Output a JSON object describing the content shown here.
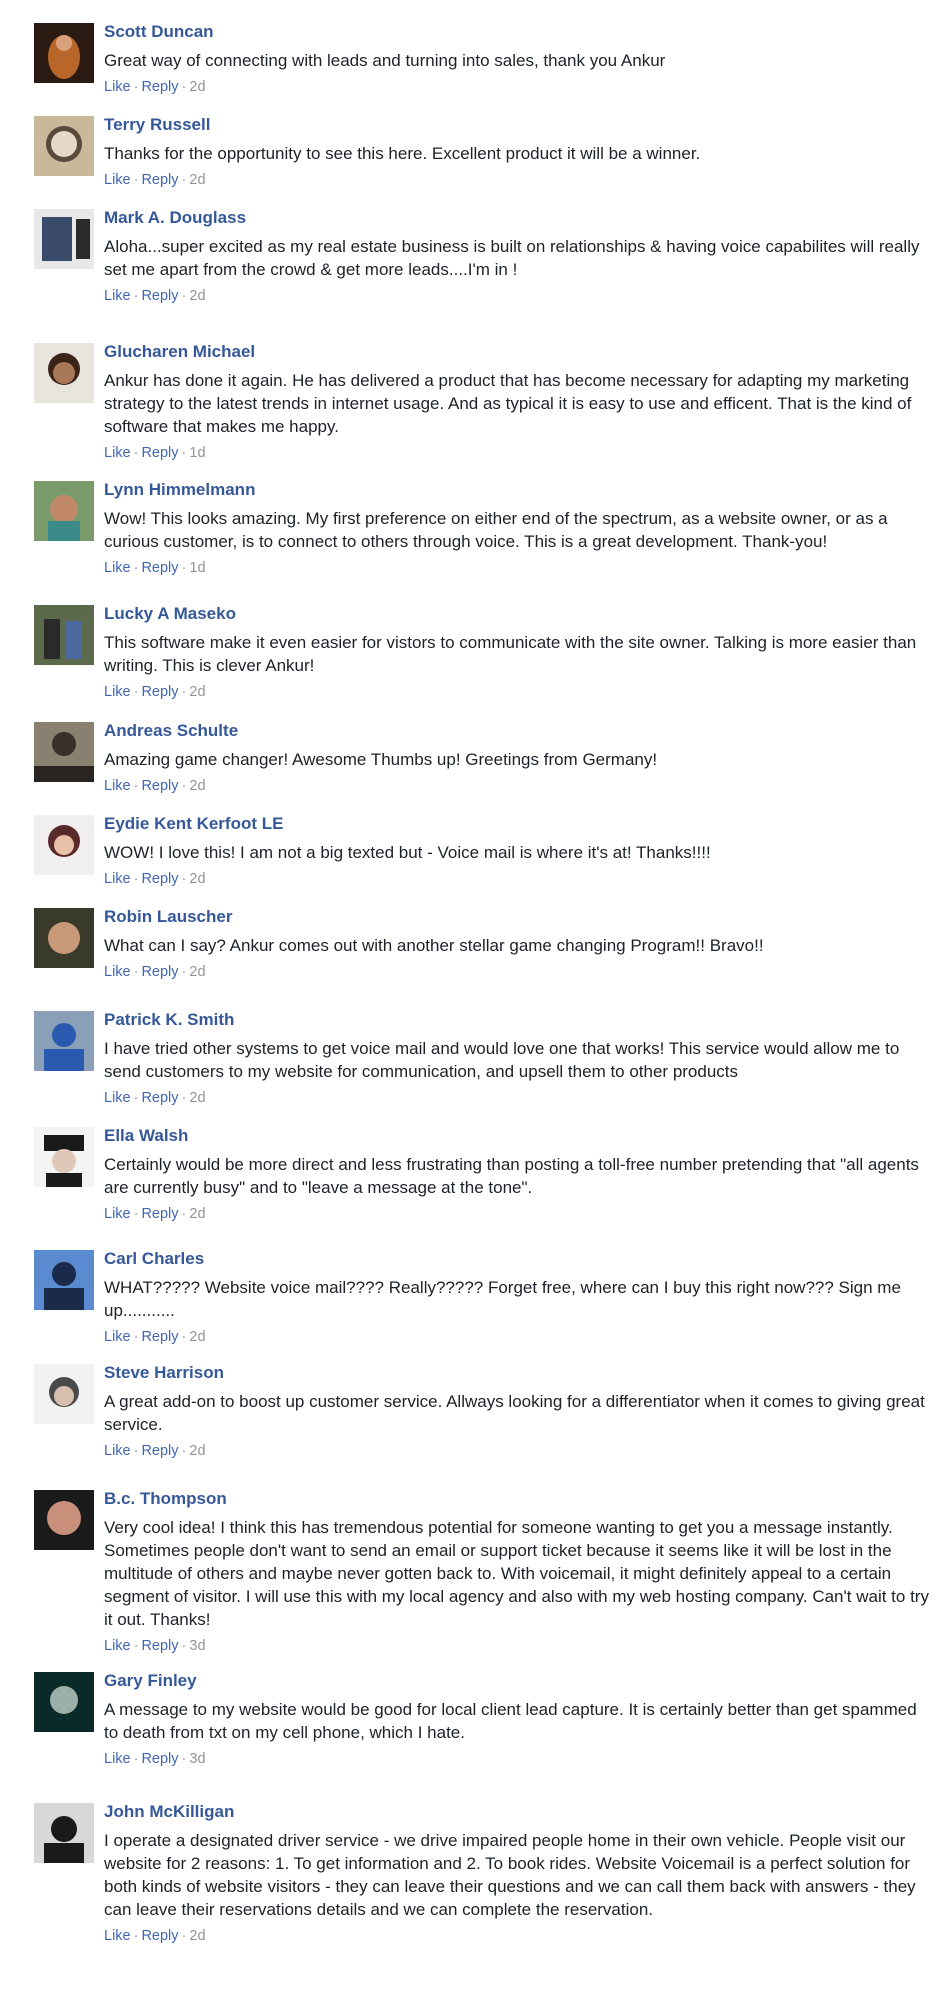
{
  "actions": {
    "like": "Like",
    "reply": "Reply",
    "separator": "·"
  },
  "comments": [
    {
      "author": "Scott Duncan",
      "text": "Great way of connecting with leads and turning into sales, thank you Ankur",
      "time": "2d",
      "avatar_colors": [
        "#2a1a12",
        "#b8662a"
      ]
    },
    {
      "author": "Terry Russell",
      "text": "Thanks for the opportunity to see this here. Excellent product it will be a winner.",
      "time": "2d",
      "avatar_colors": [
        "#c9b89a",
        "#5a4a3a"
      ]
    },
    {
      "author": "Mark A. Douglass",
      "text": "Aloha...super excited as my real estate business is built on relationships & having voice capabilites will really set me apart from the crowd & get more leads....I'm in !",
      "time": "2d",
      "avatar_colors": [
        "#e8e8e8",
        "#3a4a6a"
      ]
    },
    {
      "author": "Glucharen Michael",
      "text": "Ankur has done it again. He has delivered a product that has become necessary for adapting my marketing strategy to the latest trends in internet usage. And as typical it is easy to use and efficent. That is the kind of software that makes me happy.",
      "time": "1d",
      "avatar_colors": [
        "#e8e4de",
        "#3a2418"
      ]
    },
    {
      "author": "Lynn Himmelmann",
      "text": "Wow! This looks amazing. My first preference on either end of the spectrum, as a website owner, or as a curious customer, is to connect to others through voice. This is a great development. Thank-you!",
      "time": "1d",
      "avatar_colors": [
        "#7a9a6a",
        "#c08a6a"
      ]
    },
    {
      "author": "Lucky A Maseko",
      "text": "This software make it even easier for vistors to communicate with the site owner. Talking is more easier than writing. This is clever Ankur!",
      "time": "2d",
      "avatar_colors": [
        "#5a6a4a",
        "#2a2a2a"
      ]
    },
    {
      "author": "Andreas Schulte",
      "text": "Amazing game changer! Awesome Thumbs up! Greetings from Germany!",
      "time": "2d",
      "avatar_colors": [
        "#8a8070",
        "#3a3028"
      ]
    },
    {
      "author": "Eydie Kent Kerfoot LE",
      "text": "WOW! I love this! I am not a big texted but - Voice mail is where it's at! Thanks!!!!",
      "time": "2d",
      "avatar_colors": [
        "#f0eeee",
        "#5a2a2a"
      ]
    },
    {
      "author": "Robin Lauscher",
      "text": "What can I say? Ankur comes out with another stellar game changing Program!! Bravo!!",
      "time": "2d",
      "avatar_colors": [
        "#3a3a2a",
        "#c89a7a"
      ]
    },
    {
      "author": "Patrick K. Smith",
      "text": "I have tried other systems to get voice mail and would love one that works! This service would allow me to send customers to my website for communication, and upsell them to other products",
      "time": "2d",
      "avatar_colors": [
        "#8aa0b8",
        "#2a5ab0"
      ]
    },
    {
      "author": "Ella Walsh",
      "text": "Certainly would be more direct and less frustrating than posting a toll-free number pretending that \"all agents are currently busy\" and to \"leave a message at the tone\".",
      "time": "2d",
      "avatar_colors": [
        "#f4f4f4",
        "#1a1a1a"
      ]
    },
    {
      "author": "Carl Charles",
      "text": "WHAT????? Website voice mail???? Really????? Forget free, where can I buy this right now??? Sign me up...........",
      "time": "2d",
      "avatar_colors": [
        "#5a8ad0",
        "#1a2a4a"
      ]
    },
    {
      "author": "Steve Harrison",
      "text": "A great add-on to boost up customer service. Allways looking for a differentiator when it comes to giving great service.",
      "time": "2d",
      "avatar_colors": [
        "#f2f2f2",
        "#4a4a4a"
      ]
    },
    {
      "author": "B.c. Thompson",
      "text": "Very cool idea! I think this has tremendous potential for someone wanting to get you a message instantly. Sometimes people don't want to send an email or support ticket because it seems like it will be lost in the multitude of others and maybe never gotten back to. With voicemail, it might definitely appeal to a certain segment of visitor. I will use this with my local agency and also with my web hosting company. Can't wait to try it out. Thanks!",
      "time": "3d",
      "avatar_colors": [
        "#1a1a1a",
        "#c8907a"
      ]
    },
    {
      "author": "Gary Finley",
      "text": "A message to my website would be good for local client lead capture. It is certainly better than get spammed to death from txt on my cell phone, which I hate.",
      "time": "3d",
      "avatar_colors": [
        "#0a2a2a",
        "#9ab0a8"
      ]
    },
    {
      "author": "John McKilligan",
      "text": "I operate a designated driver service - we drive impaired people home in their own vehicle. People visit our website for 2 reasons: 1. To get information and 2. To book rides. Website Voicemail is a perfect solution for both kinds of website visitors - they can leave their questions and we can call them back with answers - they can leave their reservations details and we can complete the reservation.",
      "time": "2d",
      "avatar_colors": [
        "#d8d8d8",
        "#1a1a1a"
      ]
    }
  ]
}
